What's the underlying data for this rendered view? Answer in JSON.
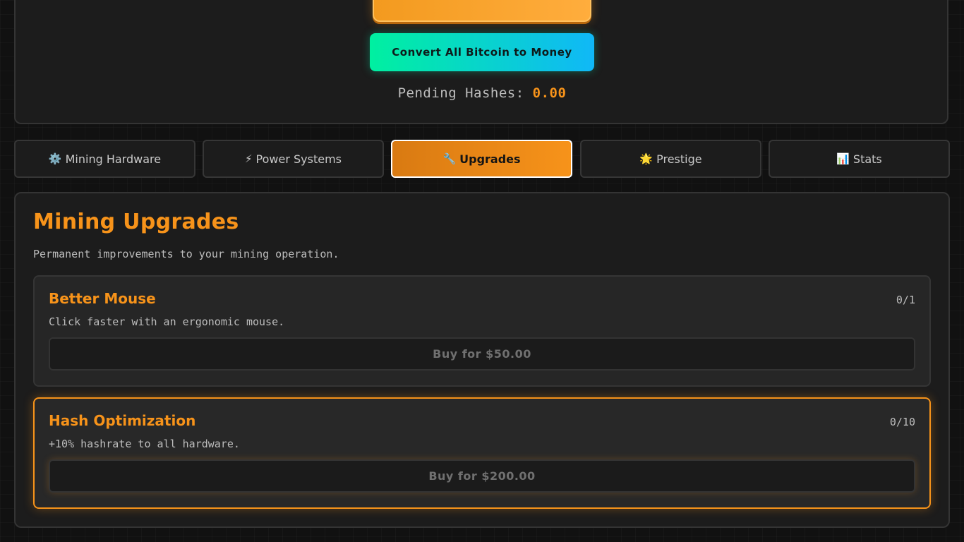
{
  "header": {
    "convert_label": "Convert All Bitcoin to Money",
    "pending_label": "Pending Hashes:",
    "pending_value": "0.00"
  },
  "tabs": [
    {
      "icon": "⚙️",
      "label": "Mining Hardware",
      "active": false
    },
    {
      "icon": "⚡",
      "label": "Power Systems",
      "active": false
    },
    {
      "icon": "🔧",
      "label": "Upgrades",
      "active": true
    },
    {
      "icon": "🌟",
      "label": "Prestige",
      "active": false
    },
    {
      "icon": "📊",
      "label": "Stats",
      "active": false
    }
  ],
  "section": {
    "title": "Mining Upgrades",
    "description": "Permanent improvements to your mining operation."
  },
  "upgrades": [
    {
      "name": "Better Mouse",
      "count": "0/1",
      "description": "Click faster with an ergonomic mouse.",
      "buy_label": "Buy for $50.00"
    },
    {
      "name": "Hash Optimization",
      "count": "0/10",
      "description": "+10% hashrate to all hardware.",
      "buy_label": "Buy for $200.00"
    }
  ],
  "colors": {
    "accent": "#f7931a",
    "convert_gradient_start": "#00f0a0",
    "convert_gradient_end": "#10b8f7",
    "panel_bg": "#1c1c1c",
    "page_bg": "#111111"
  }
}
